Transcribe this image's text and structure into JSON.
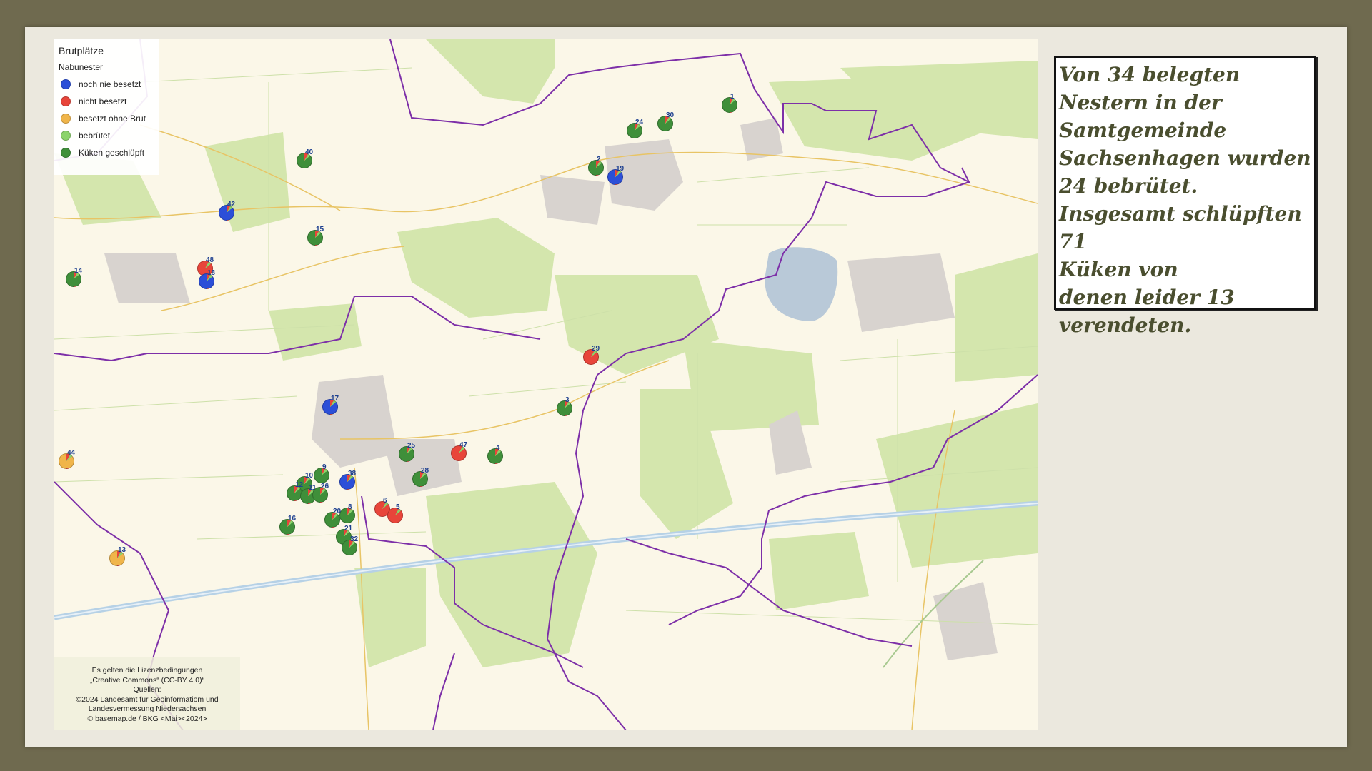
{
  "legend": {
    "title": "Brutplätze",
    "subtitle": "Nabunester",
    "items": [
      {
        "label": "noch nie besetzt",
        "color": "#2c4fd8"
      },
      {
        "label": "nicht besetzt",
        "color": "#e8453a"
      },
      {
        "label": "besetzt ohne Brut",
        "color": "#f0b54a"
      },
      {
        "label": "bebrütet",
        "color": "#8bd36a"
      },
      {
        "label": "Küken geschlüpft",
        "color": "#3f8f3a"
      }
    ]
  },
  "credits": {
    "l1": "Es gelten die Lizenzbedingungen",
    "l2": "„Creative Commons“ (CC-BY 4.0)“",
    "l3": "Quellen:",
    "l4": "©2024 Landesamt für Geoinformatiom und",
    "l5": "Landesvermessung Niedersachsen",
    "l6": "© basemap.de / BKG <Mai><2024>"
  },
  "summary": {
    "line1": "Von 34 belegten",
    "line2": "Nestern in der",
    "line3": "Samtgemeinde",
    "line4": "Sachsenhagen wurden",
    "line5": "24 bebrütet.",
    "line6": "Insgesamt schlüpften 71",
    "line7": "Küken von",
    "line8": "denen leider 13",
    "line9": "verendeten."
  },
  "nests": [
    {
      "id": "1",
      "status": "green"
    },
    {
      "id": "30",
      "status": "green"
    },
    {
      "id": "24",
      "status": "green"
    },
    {
      "id": "2",
      "status": "green"
    },
    {
      "id": "19",
      "status": "blue"
    },
    {
      "id": "40",
      "status": "green"
    },
    {
      "id": "42",
      "status": "blue"
    },
    {
      "id": "15",
      "status": "green"
    },
    {
      "id": "48",
      "status": "red"
    },
    {
      "id": "18",
      "status": "blue"
    },
    {
      "id": "14",
      "status": "green"
    },
    {
      "id": "29",
      "status": "red"
    },
    {
      "id": "17",
      "status": "blue"
    },
    {
      "id": "3",
      "status": "green"
    },
    {
      "id": "44",
      "status": "yellow"
    },
    {
      "id": "25",
      "status": "green"
    },
    {
      "id": "47",
      "status": "red"
    },
    {
      "id": "4",
      "status": "green"
    },
    {
      "id": "28",
      "status": "green"
    },
    {
      "id": "10",
      "status": "green"
    },
    {
      "id": "9",
      "status": "green"
    },
    {
      "id": "38",
      "status": "blue"
    },
    {
      "id": "12",
      "status": "green"
    },
    {
      "id": "11",
      "status": "green"
    },
    {
      "id": "26",
      "status": "green"
    },
    {
      "id": "6",
      "status": "red"
    },
    {
      "id": "5",
      "status": "red"
    },
    {
      "id": "8",
      "status": "green"
    },
    {
      "id": "20",
      "status": "green"
    },
    {
      "id": "16",
      "status": "green"
    },
    {
      "id": "21",
      "status": "green"
    },
    {
      "id": "32",
      "status": "green"
    },
    {
      "id": "13",
      "status": "yellow"
    }
  ]
}
